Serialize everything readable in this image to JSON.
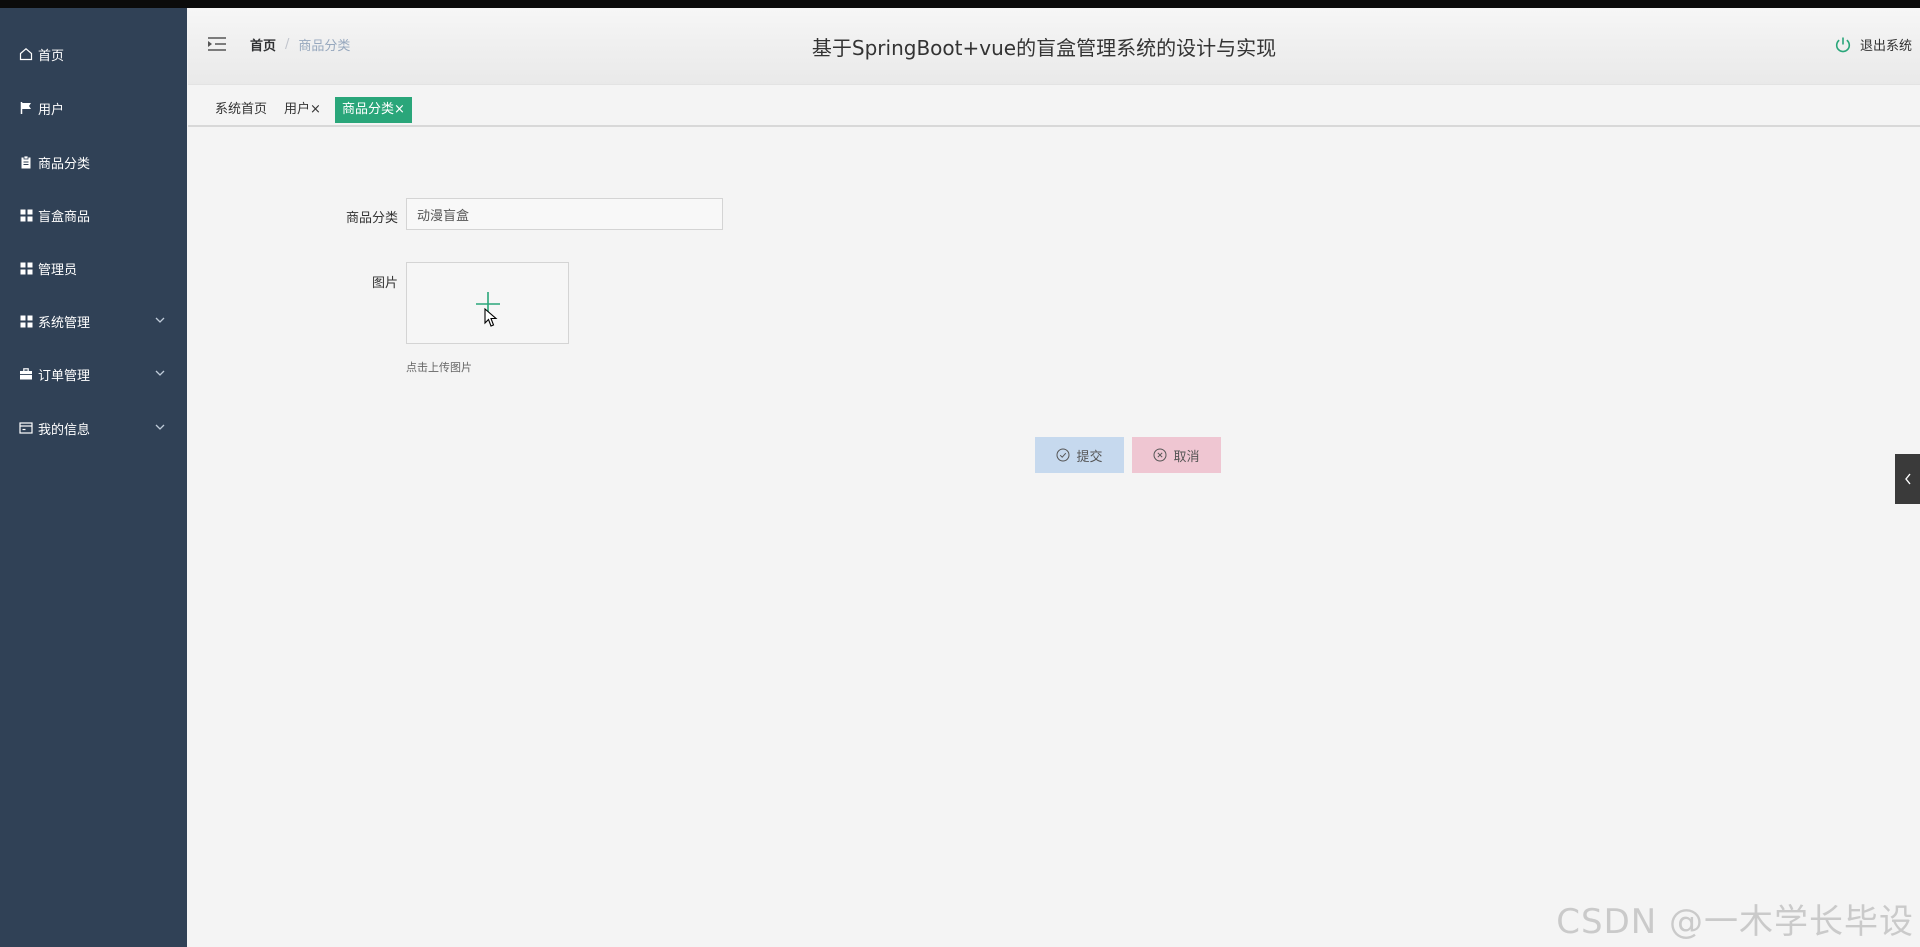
{
  "app": {
    "title": "基于SpringBoot+vue的盲盒管理系统的设计与实现",
    "logout_label": "退出系统"
  },
  "breadcrumb": {
    "home": "首页",
    "separator": "/",
    "current": "商品分类"
  },
  "sidebar": {
    "items": [
      {
        "label": "首页",
        "icon": "home-icon"
      },
      {
        "label": "用户",
        "icon": "flag-icon"
      },
      {
        "label": "商品分类",
        "icon": "clipboard-icon"
      },
      {
        "label": "盲盒商品",
        "icon": "grid-icon"
      },
      {
        "label": "管理员",
        "icon": "grid-icon"
      },
      {
        "label": "系统管理",
        "icon": "grid-icon",
        "expandable": true
      },
      {
        "label": "订单管理",
        "icon": "briefcase-icon",
        "expandable": true
      },
      {
        "label": "我的信息",
        "icon": "id-card-icon",
        "expandable": true
      }
    ]
  },
  "tags": [
    {
      "label": "系统首页",
      "closable": false
    },
    {
      "label": "用户",
      "closable": true
    },
    {
      "label": "商品分类",
      "closable": true,
      "active": true
    }
  ],
  "tag_close_glyph": "×",
  "form": {
    "category_label": "商品分类",
    "category_value": "动漫盲盒",
    "image_label": "图片",
    "upload_hint": "点击上传图片"
  },
  "buttons": {
    "submit": "提交",
    "cancel": "取消"
  },
  "watermark": "CSDN @一木学长毕设",
  "colors": {
    "sidebar_bg": "#304156",
    "accent_green": "#2aa67a",
    "submit_bg": "#c6d9ee",
    "cancel_bg": "#efc6d2"
  }
}
